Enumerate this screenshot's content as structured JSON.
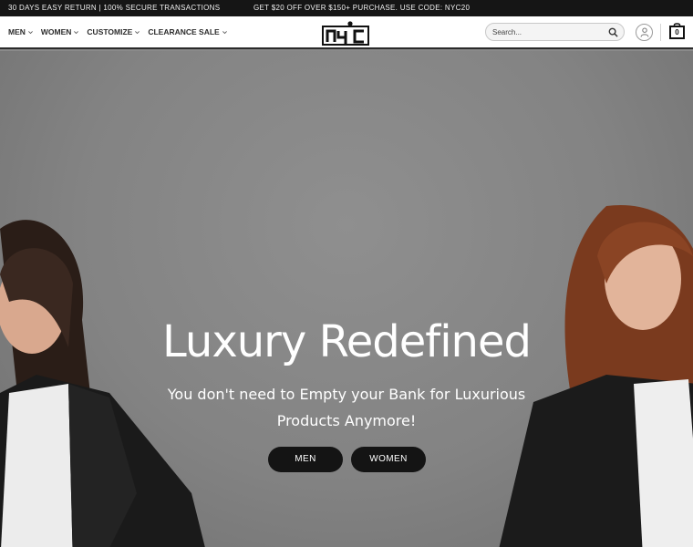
{
  "topbar": {
    "left_text": "30 DAYS EASY RETURN | 100% SECURE TRANSACTIONS",
    "promo_text": "GET $20 OFF OVER $150+ PURCHASE. USE CODE: NYC20"
  },
  "nav": {
    "items": [
      {
        "label": "MEN",
        "icon": "chevron-down-icon"
      },
      {
        "label": "WOMEN",
        "icon": "chevron-down-icon"
      },
      {
        "label": "CUSTOMIZE",
        "icon": "chevron-down-icon"
      },
      {
        "label": "CLEARANCE SALE",
        "icon": "chevron-down-icon"
      }
    ]
  },
  "logo": {
    "text": "nyc"
  },
  "search": {
    "placeholder": "Search...",
    "icon": "search-icon"
  },
  "account": {
    "icon": "user-icon"
  },
  "cart": {
    "count": "0",
    "icon": "shopping-bag-icon"
  },
  "hero": {
    "title": "Luxury Redefined",
    "subtitle": "You don't need to Empty your Bank for Luxurious Products Anymore!",
    "buttons": {
      "men": "MEN",
      "women": "WOMEN"
    }
  },
  "colors": {
    "topbar_bg": "#151515",
    "header_bg": "#ffffff",
    "hero_bg": "#8a8a8a",
    "button_bg": "#141414",
    "text_light": "#ffffff"
  }
}
